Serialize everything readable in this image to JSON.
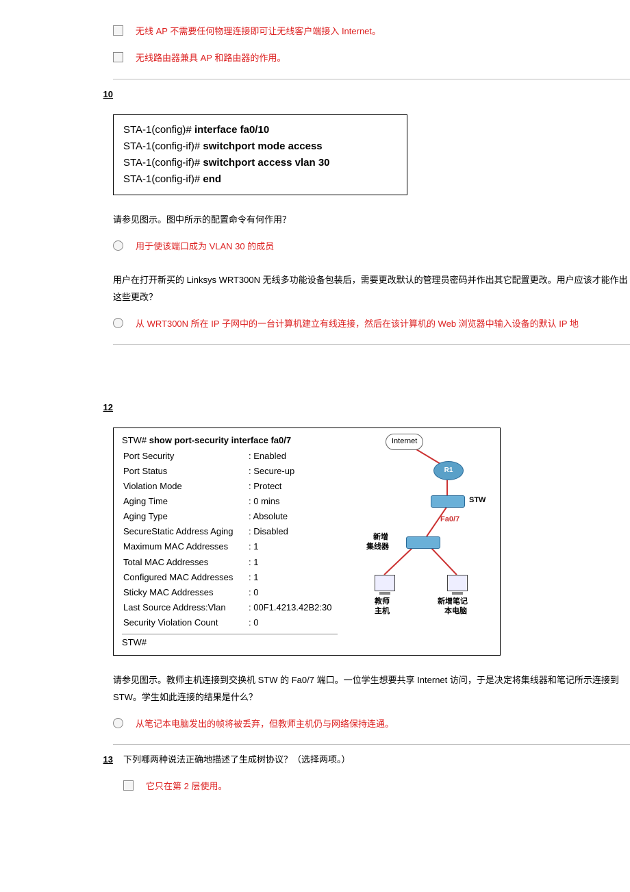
{
  "q9": {
    "opt1": "无线 AP 不需要任何物理连接即可让无线客户端接入 Internet。",
    "opt2": "无线路由器兼具 AP 和路由器的作用。"
  },
  "q10": {
    "num": "10",
    "code_l1a": "STA-1(config)# ",
    "code_l1b": "interface fa0/10",
    "code_l2a": "STA-1(config-if)# ",
    "code_l2b": "switchport mode access",
    "code_l3a": "STA-1(config-if)# ",
    "code_l3b": "switchport access vlan 30",
    "code_l4a": "STA-1(config-if)# ",
    "code_l4b": "end",
    "qtext": "请参见图示。图中所示的配置命令有何作用？",
    "ans": "用于使该端口成为 VLAN 30 的成员"
  },
  "q11": {
    "qtext": "用户在打开新买的 Linksys WRT300N 无线多功能设备包装后，需要更改默认的管理员密码并作出其它配置更改。用户应该才能作出这些更改？",
    "ans": "从 WRT300N 所在 IP 子网中的一台计算机建立有线连接，然后在该计算机的 Web 浏览器中输入设备的默认 IP 地"
  },
  "q12": {
    "num": "12",
    "cli_cmd_pfx": "STW# ",
    "cli_cmd": "show port-security interface fa0/7",
    "rows": [
      [
        "Port Security",
        ": Enabled"
      ],
      [
        "Port Status",
        ": Secure-up"
      ],
      [
        "Violation Mode",
        ": Protect"
      ],
      [
        "Aging Time",
        ": 0 mins"
      ],
      [
        "Aging Type",
        ": Absolute"
      ],
      [
        "SecureStatic Address Aging",
        ": Disabled"
      ],
      [
        "Maximum MAC Addresses",
        ": 1"
      ],
      [
        "Total MAC Addresses",
        ": 1"
      ],
      [
        "Configured MAC Addresses",
        ": 1"
      ],
      [
        "Sticky MAC Addresses",
        ": 0"
      ],
      [
        "Last Source Address:Vlan",
        ": 00F1.4213.42B2:30"
      ],
      [
        "Security Violation Count",
        ": 0"
      ]
    ],
    "prompt_end": "STW#",
    "diag": {
      "internet": "Internet",
      "r1": "R1",
      "stw": "STW",
      "fa07": "Fa0/7",
      "hub_l1": "新增",
      "hub_l2": "集线器",
      "pc1_l1": "教师",
      "pc1_l2": "主机",
      "pc2_l1": "新增笔记",
      "pc2_l2": "本电脑"
    },
    "qtext": "请参见图示。教师主机连接到交换机 STW 的 Fa0/7 端口。一位学生想要共享 Internet 访问，于是决定将集线器和笔记所示连接到 STW。学生如此连接的结果是什么？",
    "ans": "从笔记本电脑发出的帧将被丢弃，但教师主机仍与网络保持连通。"
  },
  "q13": {
    "num": "13",
    "qtext": "下列哪两种说法正确地描述了生成树协议？（选择两项。）",
    "opt1": "它只在第 2 层使用。"
  }
}
